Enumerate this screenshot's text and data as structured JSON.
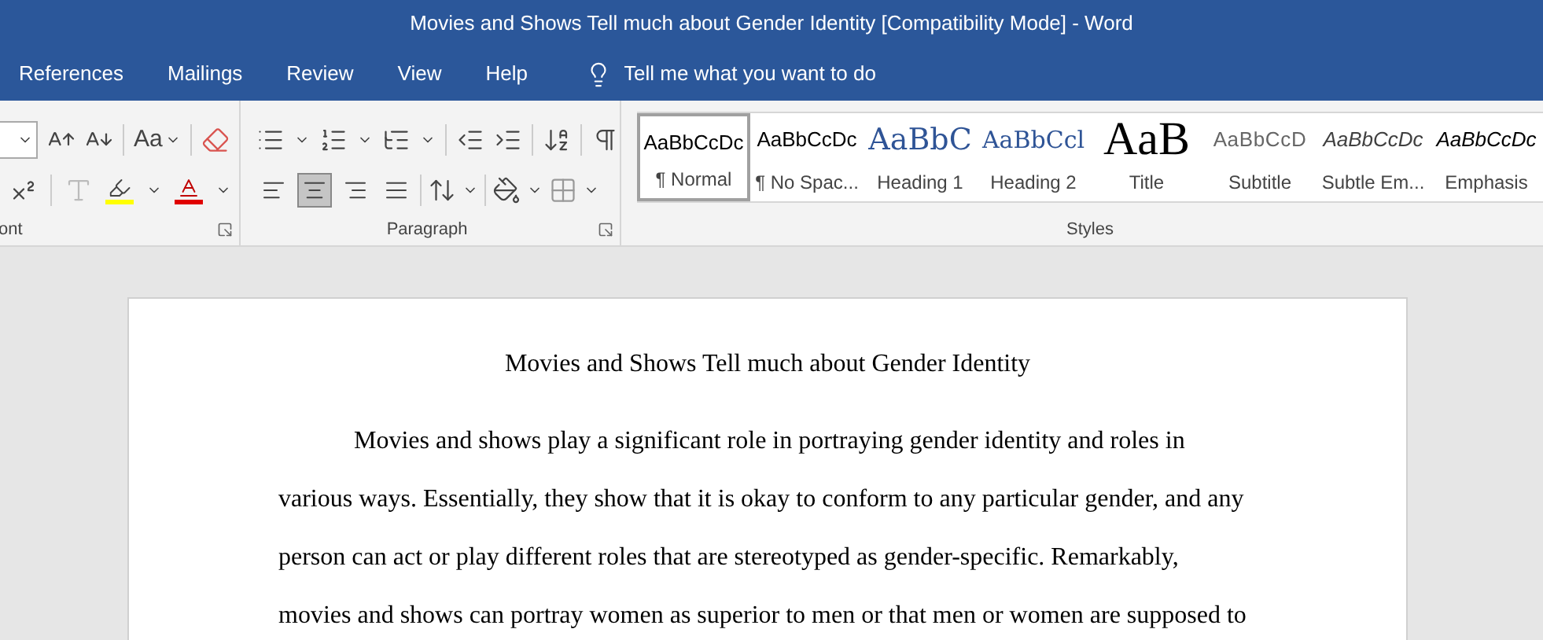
{
  "window": {
    "title": "Movies and Shows Tell much about Gender Identity [Compatibility Mode]  -  Word"
  },
  "tabs": [
    {
      "label": "References",
      "selected": false
    },
    {
      "label": "Mailings",
      "selected": false
    },
    {
      "label": "Review",
      "selected": false
    },
    {
      "label": "View",
      "selected": false
    },
    {
      "label": "Help",
      "selected": false
    }
  ],
  "tell_me": {
    "placeholder": "Tell me what you want to do"
  },
  "font_group": {
    "label": "ont",
    "case_button": "Aa"
  },
  "paragraph_group": {
    "label": "Paragraph",
    "alignment": [
      {
        "kind": "left",
        "selected": false
      },
      {
        "kind": "center",
        "selected": true
      },
      {
        "kind": "right",
        "selected": false
      },
      {
        "kind": "justify",
        "selected": false
      }
    ]
  },
  "styles_group": {
    "label": "Styles",
    "styles": [
      {
        "kind": "normal",
        "preview": "AaBbCcDc",
        "label": "¶ Normal",
        "selected": true
      },
      {
        "kind": "normal",
        "preview": "AaBbCcDc",
        "label": "¶ No Spac...",
        "selected": false
      },
      {
        "kind": "heading1",
        "preview": "AaBbC",
        "label": "Heading 1",
        "selected": false
      },
      {
        "kind": "heading2",
        "preview": "AaBbCcl",
        "label": "Heading 2",
        "selected": false
      },
      {
        "kind": "title",
        "preview": "AaB",
        "label": "Title",
        "selected": false
      },
      {
        "kind": "subtitle",
        "preview": "AaBbCcD",
        "label": "Subtitle",
        "selected": false
      },
      {
        "kind": "subtle",
        "preview": "AaBbCcDc",
        "label": "Subtle Em...",
        "selected": false
      },
      {
        "kind": "emphasis",
        "preview": "AaBbCcDc",
        "label": "Emphasis",
        "selected": false
      }
    ]
  },
  "document": {
    "title": "Movies and Shows Tell much about Gender Identity",
    "paragraph": "Movies and shows play a significant role in portraying gender identity and roles in various ways. Essentially, they show that it is okay to conform to any particular gender, and any person can act or play different roles that are stereotyped as gender-specific. Remarkably, movies and shows can portray women as superior to men or that men or women are supposed to"
  }
}
